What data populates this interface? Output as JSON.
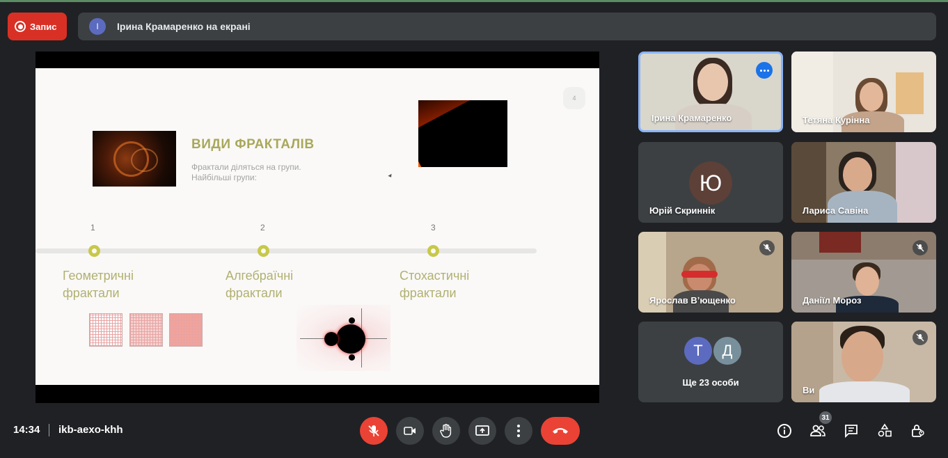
{
  "recording": {
    "label": "Запис"
  },
  "presenting": {
    "avatar_letter": "І",
    "text": "Ірина Крамаренко на екрані"
  },
  "slide": {
    "number": "4",
    "title": "ВИДИ ФРАКТАЛІВ",
    "subtitle_line1": "Фрактали діляться на групи.",
    "subtitle_line2": "Найбільші групи:",
    "timeline": [
      {
        "num": "1",
        "label_line1": "Геометричні",
        "label_line2": "фрактали"
      },
      {
        "num": "2",
        "label_line1": "Алгебраїчні",
        "label_line2": "фрактали"
      },
      {
        "num": "3",
        "label_line1": "Стохастичні",
        "label_line2": "фрактали"
      }
    ]
  },
  "participants": [
    {
      "name": "Ірина Крамаренко"
    },
    {
      "name": "Тетяна Курінна"
    },
    {
      "name": "Юрій Скриннік",
      "avatar_letter": "Ю"
    },
    {
      "name": "Лариса Савіна"
    },
    {
      "name": "Ярослав Вʼющенко"
    },
    {
      "name": "Даніїл Мороз"
    },
    {
      "label": "Ще 23 особи",
      "avatar1": "Т",
      "avatar2": "Д"
    },
    {
      "name": "Ви"
    }
  ],
  "bottom_bar": {
    "time": "14:34",
    "meeting_code": "ikb-aexo-khh",
    "participant_count": "31"
  },
  "colors": {
    "background": "#202124",
    "record": "#d93025",
    "hangup": "#ea4335",
    "active_border": "#8ab4f8",
    "slide_title": "#a9a85b"
  }
}
